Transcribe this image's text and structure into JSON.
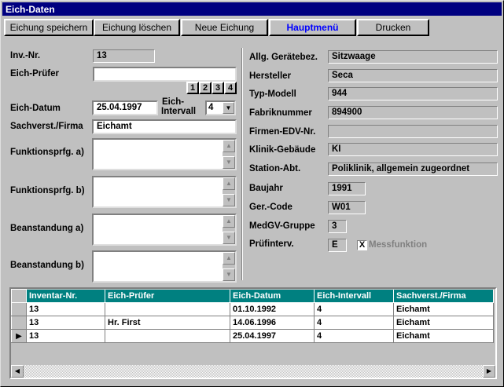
{
  "window": {
    "title": "Eich-Daten"
  },
  "toolbar": {
    "save": "Eichung speichern",
    "delete": "Eichung löschen",
    "new": "Neue Eichung",
    "mainmenu": "Hauptmenü",
    "print": "Drucken"
  },
  "left": {
    "inv_label": "Inv.-Nr.",
    "inv_value": "13",
    "pruefer_label": "Eich-Prüfer",
    "pruefer_value": "",
    "num_buttons": [
      "1",
      "2",
      "3",
      "4"
    ],
    "datum_label": "Eich-Datum",
    "datum_value": "25.04.1997",
    "intervall_label1": "Eich-",
    "intervall_label2": "Intervall",
    "intervall_value": "4",
    "sach_label": "Sachverst./Firma",
    "sach_value": "Eichamt",
    "funk_a_label": "Funktionsprfg. a)",
    "funk_b_label": "Funktionsprfg. b)",
    "bean_a_label": "Beanstandung a)",
    "bean_b_label": "Beanstandung b)"
  },
  "right": {
    "geraet_label": "Allg. Gerätebez.",
    "geraet_value": "Sitzwaage",
    "hersteller_label": "Hersteller",
    "hersteller_value": "Seca",
    "typ_label": "Typ-Modell",
    "typ_value": "944",
    "fabrik_label": "Fabriknummer",
    "fabrik_value": "894900",
    "edv_label": "Firmen-EDV-Nr.",
    "edv_value": "",
    "klinik_label": "Klinik-Gebäude",
    "klinik_value": "KI",
    "station_label": "Station-Abt.",
    "station_value": "Poliklinik, allgemein zugeordnet",
    "baujahr_label": "Baujahr",
    "baujahr_value": "1991",
    "gercode_label": "Ger.-Code",
    "gercode_value": "W01",
    "medgv_label": "MedGV-Gruppe",
    "medgv_value": "3",
    "pruefint_label": "Prüfinterv.",
    "pruefint_value": "E",
    "mess_label": "Messfunktion",
    "mess_checked": "X"
  },
  "grid": {
    "headers": [
      "Inventar-Nr.",
      "Eich-Prüfer",
      "Eich-Datum",
      "Eich-Intervall",
      "Sachverst./Firma"
    ],
    "rows": [
      [
        "13",
        "",
        "01.10.1992",
        "4",
        "Eichamt"
      ],
      [
        "13",
        "Hr. First",
        "14.06.1996",
        "4",
        "Eichamt"
      ],
      [
        "13",
        "",
        "25.04.1997",
        "4",
        "Eichamt"
      ]
    ]
  }
}
